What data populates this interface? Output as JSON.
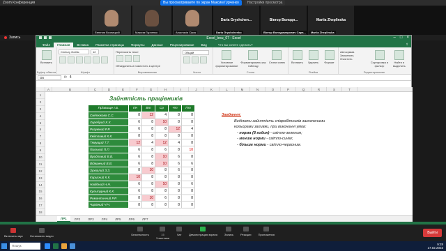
{
  "zoom": {
    "window_title": "Zoom Конференция",
    "share_label": "Вы просматриваете по экран Максим Гурченко",
    "view_options": "Настройки просмотра",
    "recording": "Запись"
  },
  "gallery": [
    {
      "name": "Евгения Возницкий",
      "kind": "video"
    },
    {
      "name": "Максим Гурченко",
      "kind": "video"
    },
    {
      "name": "Анастасія Сірик",
      "kind": "video"
    },
    {
      "name": "Daria Gryshchenko",
      "kind": "name",
      "title": "Daria Gryshchen..."
    },
    {
      "name": "Віктор Володимирович Сара...",
      "kind": "name",
      "title": "Віктор Володи..."
    },
    {
      "name": "Mariia Zheplinska",
      "kind": "name",
      "title": "Mariia Zheplinska"
    }
  ],
  "excel": {
    "title": "Excel_lesu_07 - Excel",
    "menu": [
      "Файл",
      "Главная",
      "Вставка",
      "Разметка страницы",
      "Формулы",
      "Данные",
      "Рецензирование",
      "Вид"
    ],
    "active_menu": "Главная",
    "tell_me": "Что вы хотите сделать?",
    "ribbon": {
      "paste": "Вставить",
      "clipboard": "Буфер обмена",
      "font_name": "Century Gothic",
      "font_size": "12",
      "font": "Шрифт",
      "wrap": "Переносить текст",
      "merge": "Объединить и поместить в центре",
      "alignment": "Выравнивание",
      "number_format": "Общий",
      "number": "Число",
      "conditional": "Условное форматирование",
      "format_table": "Форматировать как таблицу",
      "cell_styles": "Стили ячеек",
      "styles": "Стили",
      "insert": "Вставить",
      "delete": "Удалить",
      "format": "Формат",
      "cells": "Ячейки",
      "autosum": "Автосумма",
      "fill": "Заполнить",
      "clear": "Очистить",
      "sort": "Сортировка и фильтр",
      "find": "Найти и выделить",
      "editing": "Редактирование"
    },
    "name_box": "G6",
    "formula": "4",
    "columns": [
      "A",
      "B",
      "C",
      "D",
      "E",
      "F",
      "G",
      "H",
      "I",
      "J",
      "K",
      "L",
      "M",
      "N",
      "O",
      "P",
      "Q",
      "R",
      "S",
      "T"
    ],
    "rows": [
      "1",
      "2",
      "3",
      "4",
      "5",
      "6",
      "7",
      "8",
      "9",
      "10",
      "11",
      "12",
      "13",
      "14",
      "15",
      "16",
      "17",
      "18"
    ],
    "sheet_title": "Зайнятість працівників",
    "table": {
      "headers": [
        "Прізвище І.Б.",
        "Пн",
        "Вт",
        "Ср",
        "Чт",
        "Пт"
      ],
      "rows": [
        {
          "name": "Смітюкова С.С.",
          "vals": [
            "8",
            "12",
            "4",
            "8",
            "8"
          ],
          "hl": [
            "",
            "r",
            "",
            "",
            ""
          ]
        },
        {
          "name": "Хоребрий Х.Х.",
          "vals": [
            "6",
            "8",
            "10",
            "8",
            "8"
          ],
          "hl": [
            "",
            "",
            "r",
            "",
            ""
          ]
        },
        {
          "name": "Розумний Р.Р.",
          "vals": [
            "6",
            "8",
            "8",
            "12",
            "4"
          ],
          "hl": [
            "",
            "",
            "",
            "r",
            ""
          ]
        },
        {
          "name": "Кмітливий К.К.",
          "vals": [
            "8",
            "8",
            "8",
            "8",
            "8"
          ],
          "hl": [
            "",
            "",
            "",
            "",
            ""
          ]
        },
        {
          "name": "Тямущий Т.Т.",
          "vals": [
            "12",
            "4",
            "12",
            "4",
            "8"
          ],
          "hl": [
            "r",
            "",
            "r",
            "",
            ""
          ]
        },
        {
          "name": "Пильний П.П",
          "vals": [
            "6",
            "8",
            "6",
            "8",
            "10"
          ],
          "hl": [
            "",
            "",
            "",
            "",
            "y"
          ]
        },
        {
          "name": "Вродливий В.В.",
          "vals": [
            "6",
            "8",
            "10",
            "6",
            "8"
          ],
          "hl": [
            "",
            "",
            "r",
            "",
            ""
          ]
        },
        {
          "name": "Відважний В.В.",
          "vals": [
            "6",
            "8",
            "10",
            "6",
            "6"
          ],
          "hl": [
            "",
            "",
            "r",
            "",
            ""
          ]
        },
        {
          "name": "Зухвалий З.З.",
          "vals": [
            "8",
            "10",
            "8",
            "6",
            "8"
          ],
          "hl": [
            "",
            "r",
            "",
            "",
            ""
          ]
        },
        {
          "name": "Корисний К.К.",
          "vals": [
            "10",
            "8",
            "8",
            "8",
            "8"
          ],
          "hl": [
            "r",
            "",
            "",
            "",
            ""
          ]
        },
        {
          "name": "Надійний Н.Н.",
          "vals": [
            "6",
            "8",
            "10",
            "8",
            "6"
          ],
          "hl": [
            "",
            "",
            "r",
            "",
            ""
          ]
        },
        {
          "name": "Культурний К.К.",
          "vals": [
            "6",
            "8",
            "8",
            "8",
            "8"
          ],
          "hl": [
            "",
            "",
            "",
            "",
            ""
          ]
        },
        {
          "name": "Романтичний Р.Р.",
          "vals": [
            "8",
            "10",
            "6",
            "8",
            "8"
          ],
          "hl": [
            "",
            "r",
            "",
            "",
            ""
          ]
        },
        {
          "name": "Чарівний Ч.Ч.",
          "vals": [
            "8",
            "8",
            "8",
            "8",
            "8"
          ],
          "hl": [
            "",
            "",
            "",
            "",
            ""
          ]
        }
      ]
    },
    "task": {
      "heading": "Завдання:",
      "line1": "Виділити зайнятість співробітників зазначеними",
      "line2": "кольорами заливки, при виконанні умов:",
      "b1_key": "норма (8 годин)",
      "b1_rest": " - світло-зеленим;",
      "b2_key": "менше норми",
      "b2_rest": " - світло-синім;",
      "b3_key": "більше норми",
      "b3_rest": " - світло-червоним."
    },
    "sheet_tabs": [
      "ЛР1",
      "ЛР2",
      "ЛР3",
      "ЛР4",
      "ЛР5",
      "ЛР6",
      "ЛР7"
    ],
    "active_tab": "ЛР1"
  },
  "zoom_toolbar": {
    "left": [
      {
        "label": "Включить звук",
        "icon": "mic-off-icon"
      },
      {
        "label": "Остановить видео",
        "icon": "video-icon"
      }
    ],
    "center": [
      {
        "label": "Безопасность",
        "icon": "shield-icon"
      },
      {
        "label": "Участники",
        "icon": "participants-icon"
      },
      {
        "label": "Чат",
        "icon": "chat-icon"
      },
      {
        "label": "Демонстрация экрана",
        "icon": "share-screen-icon"
      },
      {
        "label": "Запись",
        "icon": "record-icon"
      },
      {
        "label": "Реакции",
        "icon": "reactions-icon"
      },
      {
        "label": "Приложения",
        "icon": "apps-icon"
      }
    ],
    "participants_count": "15",
    "end": "Выйти"
  },
  "taskbar": {
    "search": "Пошук",
    "time": "9:28",
    "date": "17.02.2023"
  }
}
